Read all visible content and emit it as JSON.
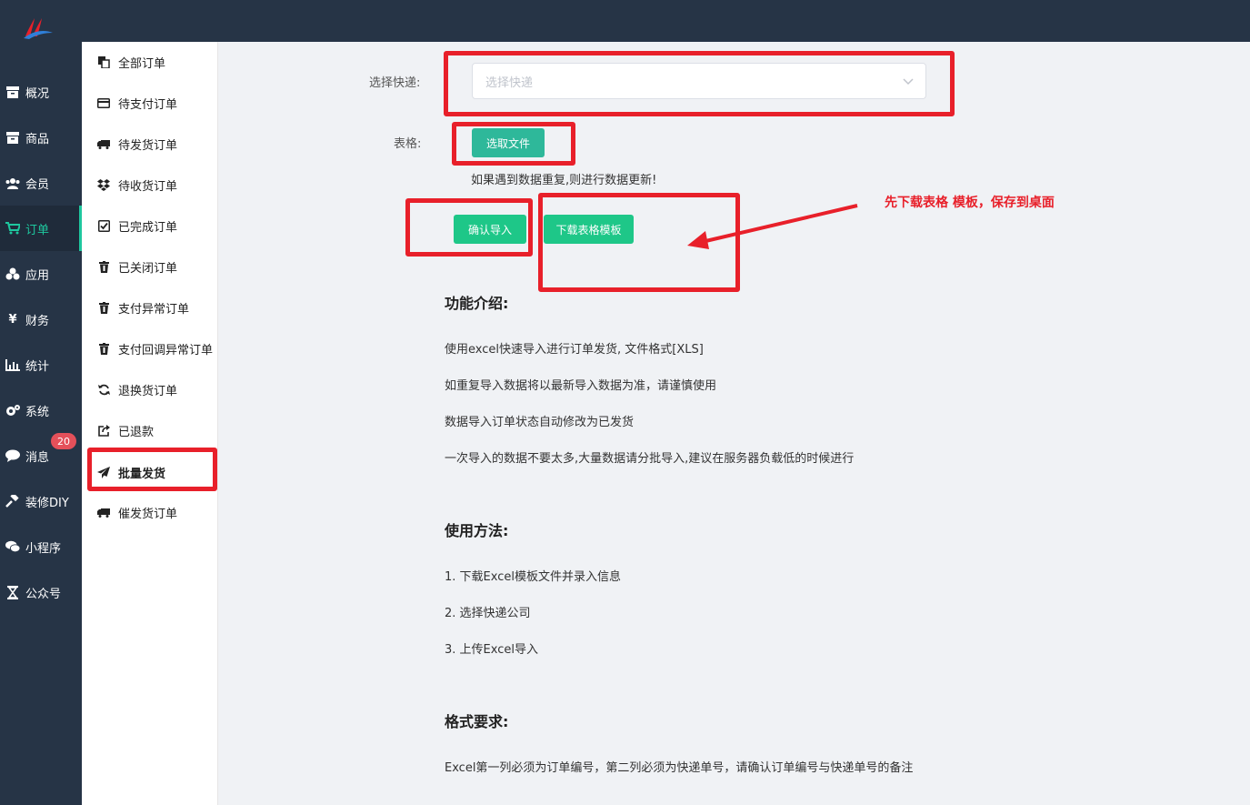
{
  "colors": {
    "topbar": "#263446",
    "accent": "#1ec79e",
    "button": "#1ec788",
    "annotation": "#e8202a",
    "badge": "#e4505a"
  },
  "nav": {
    "items": [
      {
        "icon": "archive-icon",
        "label": "概况"
      },
      {
        "icon": "archive-icon",
        "label": "商品"
      },
      {
        "icon": "users-icon",
        "label": "会员"
      },
      {
        "icon": "cart-icon",
        "label": "订单"
      },
      {
        "icon": "cubes-icon",
        "label": "应用"
      },
      {
        "icon": "yen-icon",
        "label": "财务"
      },
      {
        "icon": "bar-chart-icon",
        "label": "统计"
      },
      {
        "icon": "gears-icon",
        "label": "系统"
      },
      {
        "icon": "comment-icon",
        "label": "消息"
      },
      {
        "icon": "gavel-icon",
        "label": "装修DIY"
      },
      {
        "icon": "wechat-icon",
        "label": "小程序"
      },
      {
        "icon": "hourglass-icon",
        "label": "公众号"
      }
    ],
    "active_index": 3,
    "message_badge": "20"
  },
  "subnav": {
    "items": [
      {
        "icon": "copy-icon",
        "label": "全部订单"
      },
      {
        "icon": "credit-card-icon",
        "label": "待支付订单"
      },
      {
        "icon": "truck-icon",
        "label": "待发货订单"
      },
      {
        "icon": "dropbox-icon",
        "label": "待收货订单"
      },
      {
        "icon": "check-square-icon",
        "label": "已完成订单"
      },
      {
        "icon": "trash-icon",
        "label": "已关闭订单"
      },
      {
        "icon": "trash-icon",
        "label": "支付异常订单"
      },
      {
        "icon": "trash-icon",
        "label": "支付回调异常订单"
      },
      {
        "icon": "refresh-icon",
        "label": "退换货订单"
      },
      {
        "icon": "share-icon",
        "label": "已退款"
      },
      {
        "icon": "paper-plane-icon",
        "label": "批量发货"
      },
      {
        "icon": "truck-icon",
        "label": "催发货订单"
      }
    ],
    "active_index": 10
  },
  "form": {
    "express_label": "选择快递:",
    "express_placeholder": "选择快递",
    "sheet_label": "表格:",
    "choose_file": "选取文件",
    "hint": "如果遇到数据重复,则进行数据更新!",
    "confirm_import": "确认导入",
    "download_template": "下载表格模板"
  },
  "annotation": {
    "text": "先下载表格 模板，保存到桌面"
  },
  "sections": {
    "intro_title": "功能介绍:",
    "intro": [
      "使用excel快速导入进行订单发货, 文件格式[XLS]",
      "如重复导入数据将以最新导入数据为准，请谨慎使用",
      "数据导入订单状态自动修改为已发货",
      "一次导入的数据不要太多,大量数据请分批导入,建议在服务器负载低的时候进行"
    ],
    "usage_title": "使用方法:",
    "usage": [
      "1. 下载Excel模板文件并录入信息",
      "2. 选择快递公司",
      "3. 上传Excel导入"
    ],
    "format_title": "格式要求:",
    "format": [
      "Excel第一列必须为订单编号，第二列必须为快递单号，请确认订单编号与快递单号的备注"
    ]
  }
}
